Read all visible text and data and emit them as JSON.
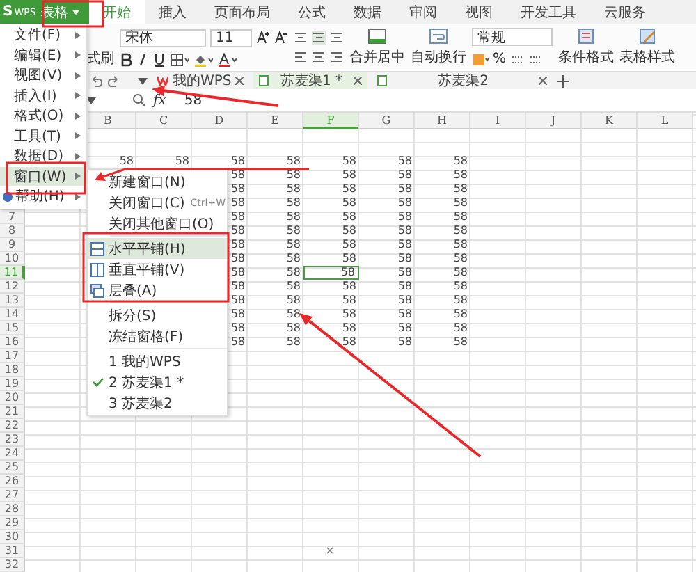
{
  "app": {
    "mark": "S",
    "logo": "WPS",
    "product": "表格"
  },
  "menu_tabs": [
    {
      "label": "开始",
      "selected": true
    },
    {
      "label": "插入",
      "selected": false
    },
    {
      "label": "页面布局",
      "selected": false
    },
    {
      "label": "公式",
      "selected": false
    },
    {
      "label": "数据",
      "selected": false
    },
    {
      "label": "审阅",
      "selected": false
    },
    {
      "label": "视图",
      "selected": false
    },
    {
      "label": "开发工具",
      "selected": false
    },
    {
      "label": "云服务",
      "selected": false
    }
  ],
  "ribbon": {
    "format_painter": "式刷",
    "font_name": "宋体",
    "font_size": "11",
    "merge": "合并居中",
    "wrap": "自动换行",
    "number_format": "常规",
    "percent": "%",
    "conditional": "条件格式",
    "table_style": "表格样式"
  },
  "doc_tabs": [
    {
      "label": "我的WPS",
      "selected": false
    },
    {
      "label": "苏麦渠1 *",
      "selected": true
    },
    {
      "label": "苏麦渠2",
      "selected": false
    }
  ],
  "formula_bar": {
    "function_label": "fx",
    "value": "58"
  },
  "sheet": {
    "columns": [
      {},
      {
        "label": "B",
        "selected": false
      },
      {
        "label": "C",
        "selected": false
      },
      {
        "label": "D",
        "selected": false
      },
      {
        "label": "E",
        "selected": false
      },
      {
        "label": "F",
        "selected": true
      },
      {
        "label": "G",
        "selected": false
      },
      {
        "label": "H",
        "selected": false
      },
      {
        "label": "I",
        "selected": false
      },
      {
        "label": "J",
        "selected": false
      },
      {
        "label": "K",
        "selected": false
      },
      {
        "label": "L",
        "selected": false
      }
    ],
    "rows": [
      {},
      {},
      {
        "cells": {
          "B": "58",
          "C": "58",
          "D": "58",
          "E": "58",
          "F": "58",
          "G": "58",
          "H": "58"
        }
      },
      {
        "cells": {
          "D": "58",
          "E": "58",
          "F": "58",
          "G": "58",
          "H": "58"
        }
      },
      {
        "cells": {
          "D": "58",
          "E": "58",
          "F": "58",
          "G": "58",
          "H": "58"
        }
      },
      {
        "cells": {
          "D": "58",
          "E": "58",
          "F": "58",
          "G": "58",
          "H": "58"
        }
      },
      {
        "header": "7",
        "selected": false,
        "cells": {
          "D": "58",
          "E": "58",
          "F": "58",
          "G": "58",
          "H": "58"
        }
      },
      {
        "header": "8",
        "selected": false,
        "cells": {
          "D": "58",
          "E": "58",
          "F": "58",
          "G": "58",
          "H": "58"
        }
      },
      {
        "header": "9",
        "selected": false,
        "cells": {
          "D": "58",
          "E": "58",
          "F": "58",
          "G": "58",
          "H": "58"
        }
      },
      {
        "header": "10",
        "selected": false,
        "cells": {
          "D": "58",
          "E": "58",
          "F": "58",
          "G": "58",
          "H": "58"
        }
      },
      {
        "header": "11",
        "selected": true,
        "cells": {
          "D": "58",
          "E": "58",
          "F": "58",
          "G": "58",
          "H": "58"
        }
      },
      {
        "header": "12",
        "selected": false,
        "cells": {
          "D": "58",
          "E": "58",
          "F": "58",
          "G": "58",
          "H": "58"
        }
      },
      {
        "header": "13",
        "selected": false,
        "cells": {
          "D": "58",
          "E": "58",
          "F": "58",
          "G": "58",
          "H": "58"
        }
      },
      {
        "header": "14",
        "selected": false,
        "cells": {
          "D": "58",
          "E": "58",
          "F": "58",
          "G": "58",
          "H": "58"
        }
      },
      {
        "header": "15",
        "selected": false,
        "cells": {
          "D": "58",
          "E": "58",
          "F": "58",
          "G": "58",
          "H": "58"
        }
      },
      {
        "header": "16",
        "selected": false,
        "cells": {
          "D": "58",
          "E": "58",
          "F": "58",
          "G": "58",
          "H": "58"
        }
      },
      {
        "header": "17",
        "selected": false
      },
      {
        "header": "18",
        "selected": false
      },
      {
        "header": "19",
        "selected": false
      },
      {
        "header": "20",
        "selected": false
      },
      {
        "header": "21",
        "selected": false
      },
      {
        "header": "22",
        "selected": false
      },
      {
        "header": "23",
        "selected": false
      },
      {
        "header": "24",
        "selected": false
      },
      {
        "header": "25",
        "selected": false
      },
      {
        "header": "26",
        "selected": false
      },
      {
        "header": "27",
        "selected": false
      },
      {
        "header": "28",
        "selected": false
      },
      {
        "header": "29",
        "selected": false
      },
      {
        "header": "30",
        "selected": false
      },
      {
        "header": "31",
        "selected": false,
        "cells": {
          "F": "×"
        }
      },
      {
        "header": "32",
        "selected": false
      }
    ]
  },
  "main_menu": [
    {
      "label": "文件(F)",
      "selected": false
    },
    {
      "label": "编辑(E)",
      "selected": false
    },
    {
      "label": "视图(V)",
      "selected": false
    },
    {
      "label": "插入(I)",
      "selected": false
    },
    {
      "label": "格式(O)",
      "selected": false
    },
    {
      "label": "工具(T)",
      "selected": false
    },
    {
      "label": "数据(D)",
      "selected": false
    },
    {
      "label": "窗口(W)",
      "selected": true
    },
    {
      "label": "帮助(H)",
      "selected": false,
      "kind": "help"
    }
  ],
  "window_menu": [
    {
      "kind": "item",
      "label": "新建窗口(N)",
      "selected": false,
      "checked": false
    },
    {
      "kind": "item",
      "label": "关闭窗口(C)",
      "shortcut": "Ctrl+W",
      "selected": false,
      "checked": false
    },
    {
      "kind": "item",
      "label": "关闭其他窗口(O)",
      "selected": false,
      "checked": false
    },
    {
      "kind": "separator"
    },
    {
      "kind": "tile_horizontal",
      "label": "水平平铺(H)",
      "selected": true,
      "checked": false
    },
    {
      "kind": "tile_vertical",
      "label": "垂直平铺(V)",
      "selected": false,
      "checked": false
    },
    {
      "kind": "cascade",
      "label": "层叠(A)",
      "selected": false,
      "checked": false
    },
    {
      "kind": "separator"
    },
    {
      "kind": "item",
      "label": "拆分(S)",
      "selected": false,
      "checked": false
    },
    {
      "kind": "item",
      "label": "冻结窗格(F)",
      "selected": false,
      "checked": false
    },
    {
      "kind": "separator"
    },
    {
      "kind": "item",
      "label": "1 我的WPS",
      "selected": false,
      "checked": false
    },
    {
      "kind": "item",
      "label": "2 苏麦渠1 *",
      "selected": false,
      "checked": true
    },
    {
      "kind": "item",
      "label": "3 苏麦渠2",
      "selected": false,
      "checked": false
    }
  ]
}
